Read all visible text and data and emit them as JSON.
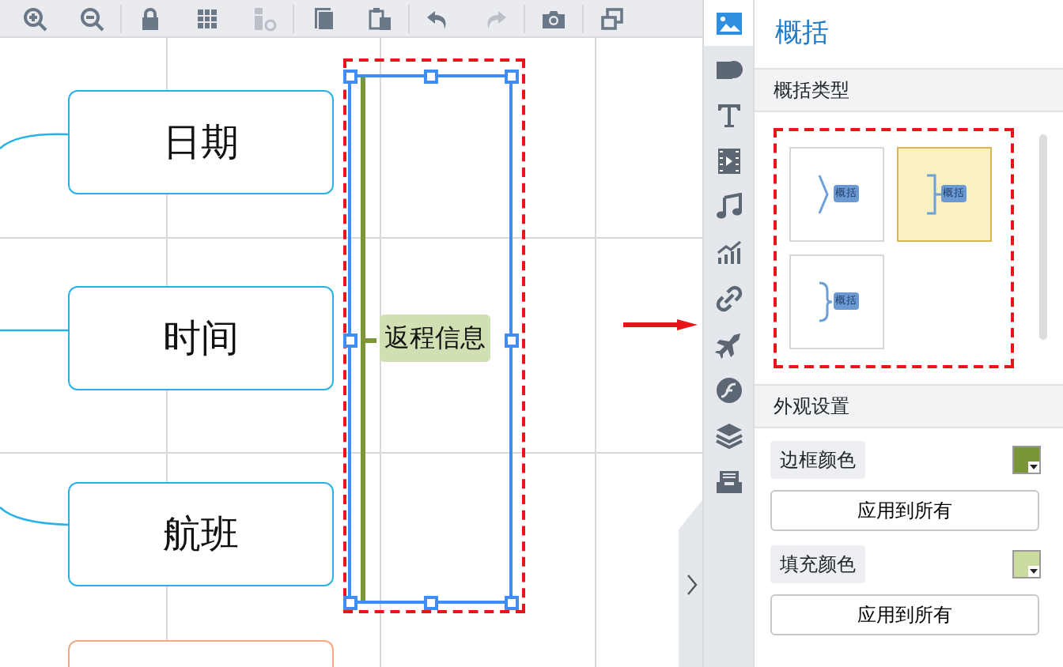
{
  "toolbar": [
    {
      "kind": "zoom-in",
      "disabled": false
    },
    {
      "kind": "zoom-out",
      "disabled": false
    },
    {
      "kind": "lock",
      "disabled": false
    },
    {
      "kind": "grid",
      "disabled": false
    },
    {
      "kind": "layout",
      "disabled": true
    },
    {
      "kind": "copy",
      "disabled": false
    },
    {
      "kind": "paste",
      "disabled": false
    },
    {
      "kind": "undo",
      "disabled": false
    },
    {
      "kind": "redo",
      "disabled": true
    },
    {
      "kind": "camera",
      "disabled": false
    },
    {
      "kind": "window",
      "disabled": false
    }
  ],
  "canvas": {
    "topics": [
      {
        "label": "日期"
      },
      {
        "label": "时间"
      },
      {
        "label": "航班"
      }
    ],
    "summary": {
      "label": "返程信息",
      "selected": true
    }
  },
  "side_tabs": [
    {
      "kind": "image",
      "selected": true
    },
    {
      "kind": "shape",
      "selected": false
    },
    {
      "kind": "text",
      "selected": false
    },
    {
      "kind": "video",
      "selected": false
    },
    {
      "kind": "music",
      "selected": false
    },
    {
      "kind": "chart",
      "selected": false
    },
    {
      "kind": "link",
      "selected": false
    },
    {
      "kind": "plane",
      "selected": false
    },
    {
      "kind": "flash",
      "selected": false
    },
    {
      "kind": "layers",
      "selected": false
    },
    {
      "kind": "tray",
      "selected": false
    }
  ],
  "panel": {
    "title": "概括",
    "types_header": "概括类型",
    "summary_types": [
      {
        "kind": "angle",
        "label": "概括",
        "selected": false
      },
      {
        "kind": "square",
        "label": "概括",
        "selected": true
      },
      {
        "kind": "curly",
        "label": "概括",
        "selected": false
      }
    ],
    "appearance_header": "外观设置",
    "appearance": [
      {
        "label": "边框颜色",
        "color": "#7a9638",
        "button": "应用到所有"
      },
      {
        "label": "填充颜色",
        "color": "#c9dba0",
        "button": "应用到所有"
      }
    ]
  }
}
